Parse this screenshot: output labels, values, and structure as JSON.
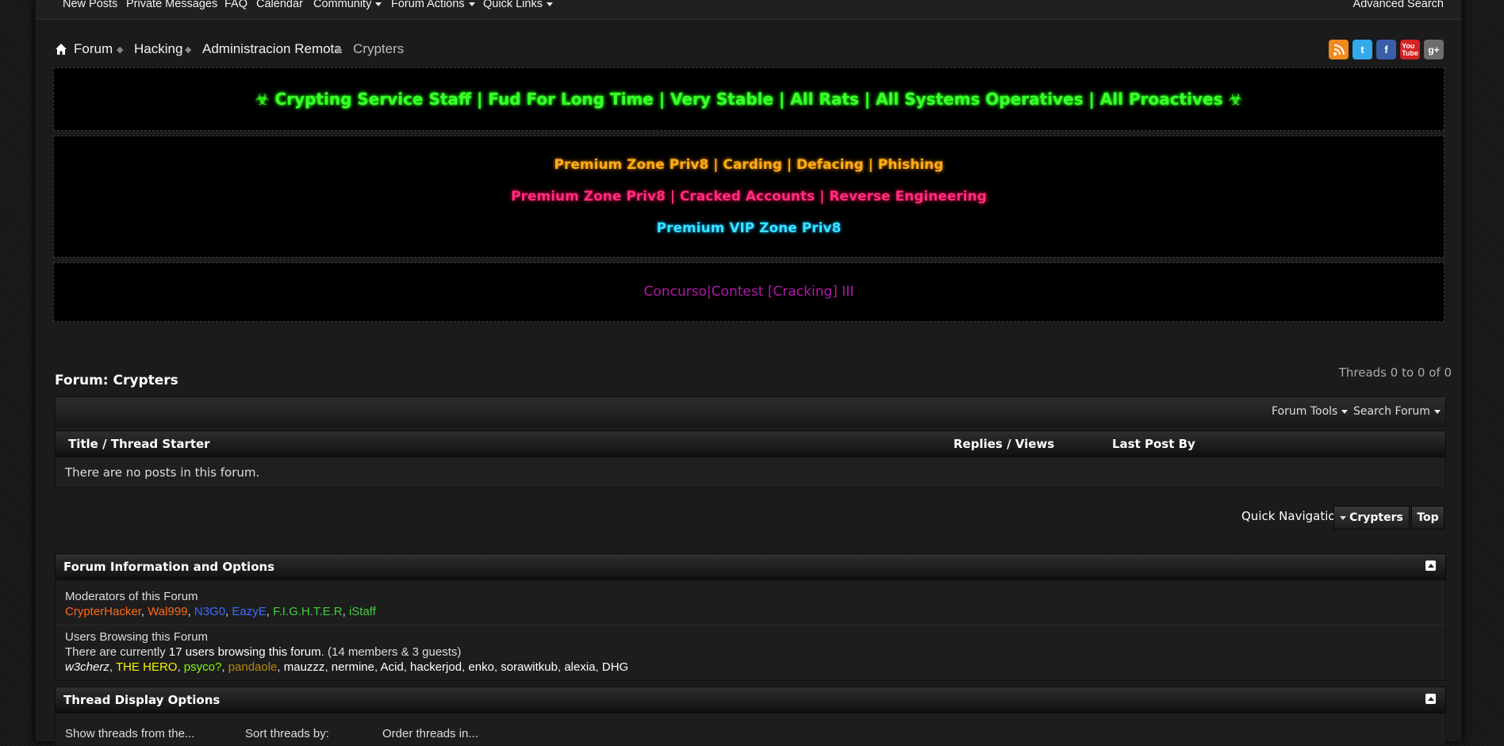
{
  "topnav": {
    "items": [
      "New Posts",
      "Private Messages",
      "FAQ",
      "Calendar",
      "Community",
      "Forum Actions",
      "Quick Links"
    ],
    "advanced_search": "Advanced Search"
  },
  "breadcrumb": {
    "items": [
      "Forum",
      "Hacking",
      "Administracion Remota"
    ],
    "current": "Crypters"
  },
  "social": [
    "rss-icon",
    "twitter-icon",
    "facebook-icon",
    "youtube-icon",
    "google-plus-icon"
  ],
  "banners": {
    "crypting": "☣ Crypting Service Staff | Fud For Long Time | Very Stable | All Rats | All Systems Operatives | All Proactives ☣",
    "premium_line1": "Premium Zone Priv8 | Carding | Defacing | Phishing",
    "premium_line2": "Premium Zone Priv8 | Cracked Accounts | Reverse Engineering",
    "premium_line3": "Premium VIP Zone Priv8",
    "contest": "Concurso|Contest [Cracking] III"
  },
  "forum": {
    "title": "Forum: Crypters",
    "thread_count": "Threads 0 to 0 of 0",
    "forum_tools": "Forum Tools",
    "search_forum": "Search Forum",
    "columns": {
      "title": "Title / Thread Starter",
      "replies": "Replies / Views",
      "last_post": "Last Post By"
    },
    "empty_message": "There are no posts in this forum."
  },
  "quick_nav": {
    "label": "Quick Navigation",
    "current": "Crypters",
    "top": "Top"
  },
  "info": {
    "heading": "Forum Information and Options",
    "moderators_label": "Moderators of this Forum",
    "moderators": [
      {
        "name": "CrypterHacker",
        "color": "#ff6a1a"
      },
      {
        "name": "Wal999",
        "color": "#ff6a1a"
      },
      {
        "name": "N3G0",
        "color": "#3a6bff"
      },
      {
        "name": "EazyE",
        "color": "#3a6bff"
      },
      {
        "name": "F.I.G.H.T.E.R",
        "color": "#3fcf3f"
      },
      {
        "name": "iStaff",
        "color": "#3fcf3f"
      }
    ],
    "browsing_label": "Users Browsing this Forum",
    "browsing_prefix": "There are currently ",
    "browsing_bold": "17 users browsing this forum",
    "browsing_suffix": ". (14 members & 3 guests)",
    "users": [
      {
        "name": "w3cherz",
        "color": "#ffffff",
        "italic": true
      },
      {
        "name": "THE HERO",
        "color": "#f5f500"
      },
      {
        "name": "psyco?",
        "color": "#7fff00"
      },
      {
        "name": "pandaole",
        "color": "#b8860b"
      },
      {
        "name": "mauzzz",
        "color": "#ffffff"
      },
      {
        "name": "nermine",
        "color": "#ffffff"
      },
      {
        "name": "Acid",
        "color": "#ffffff"
      },
      {
        "name": "hackerjod",
        "color": "#ffffff"
      },
      {
        "name": "enko",
        "color": "#ffffff"
      },
      {
        "name": "sorawitkub",
        "color": "#ffffff"
      },
      {
        "name": "alexia",
        "color": "#ffffff"
      },
      {
        "name": "DHG",
        "color": "#ffffff"
      }
    ]
  },
  "display_options": {
    "heading": "Thread Display Options",
    "show_threads": "Show threads from the...",
    "sort_by": "Sort threads by:",
    "order": "Order threads in..."
  }
}
